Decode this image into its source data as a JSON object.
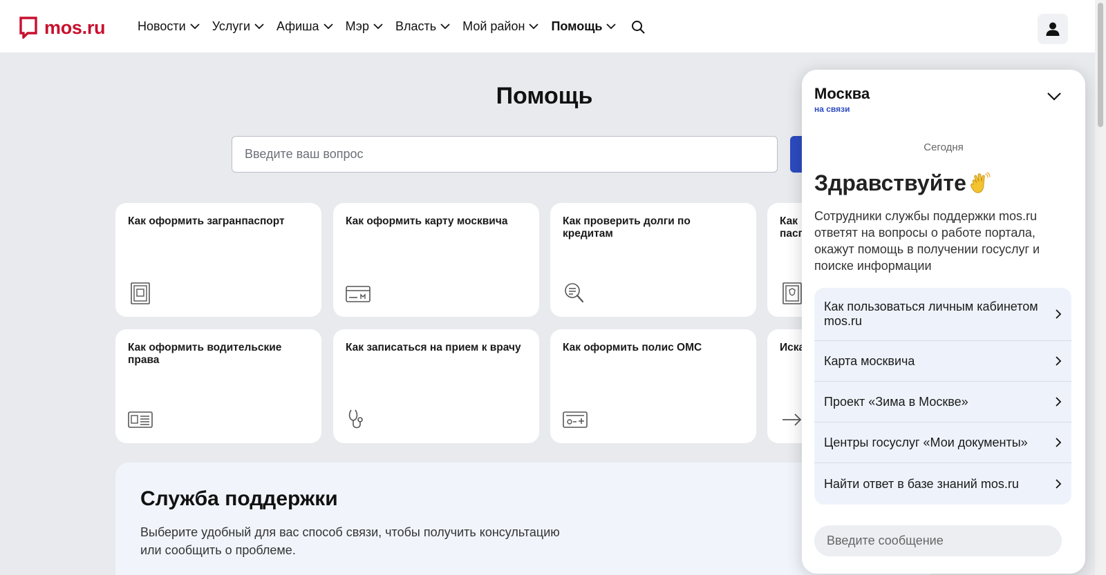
{
  "header": {
    "logo_text": "mos.ru",
    "nav": [
      {
        "label": "Новости"
      },
      {
        "label": "Услуги"
      },
      {
        "label": "Афиша"
      },
      {
        "label": "Мэр"
      },
      {
        "label": "Власть"
      },
      {
        "label": "Мой район"
      },
      {
        "label": "Помощь"
      }
    ]
  },
  "main": {
    "title": "Помощь",
    "search_placeholder": "Введите ваш вопрос",
    "cards": [
      {
        "title": "Как оформить загранпаспорт",
        "icon": "passport-icon"
      },
      {
        "title": "Как оформить карту москвича",
        "icon": "card-icon"
      },
      {
        "title": "Как проверить долги по кредитам",
        "icon": "magnifier-doc-icon"
      },
      {
        "title": "Как ... пасп...",
        "icon": "passport-emblem-icon"
      },
      {
        "title": "Как оформить водительские права",
        "icon": "license-icon"
      },
      {
        "title": "Как записаться на прием к врачу",
        "icon": "stethoscope-icon"
      },
      {
        "title": "Как оформить полис ОМС",
        "icon": "medical-card-icon"
      },
      {
        "title": "Иска...",
        "icon": "arrow-right-icon"
      }
    ],
    "card4_line1": "Как",
    "card4_line2": "пасп",
    "card8_title": "Иска"
  },
  "support": {
    "title": "Служба поддержки",
    "text": "Выберите удобный для вас способ связи, чтобы получить консультацию или сообщить о проблеме."
  },
  "chat": {
    "name": "Москва",
    "status": "на связи",
    "day": "Сегодня",
    "greeting": "Здравствуйте",
    "intro": "Сотрудники службы поддержки mos.ru ответят на вопросы о работе портала, окажут помощь в получении госуслуг и поиске информации",
    "menu": [
      {
        "label": "Как пользоваться личным кабинетом mos.ru"
      },
      {
        "label": "Карта москвича"
      },
      {
        "label": "Проект «Зима в Москве»"
      },
      {
        "label": "Центры госуслуг «Мои документы»"
      },
      {
        "label": "Найти ответ в базе знаний mos.ru"
      }
    ],
    "input_placeholder": "Введите сообщение"
  },
  "colors": {
    "brand_red": "#c8102e",
    "accent_blue": "#2c4bbf",
    "page_bg": "#e8eaee"
  }
}
